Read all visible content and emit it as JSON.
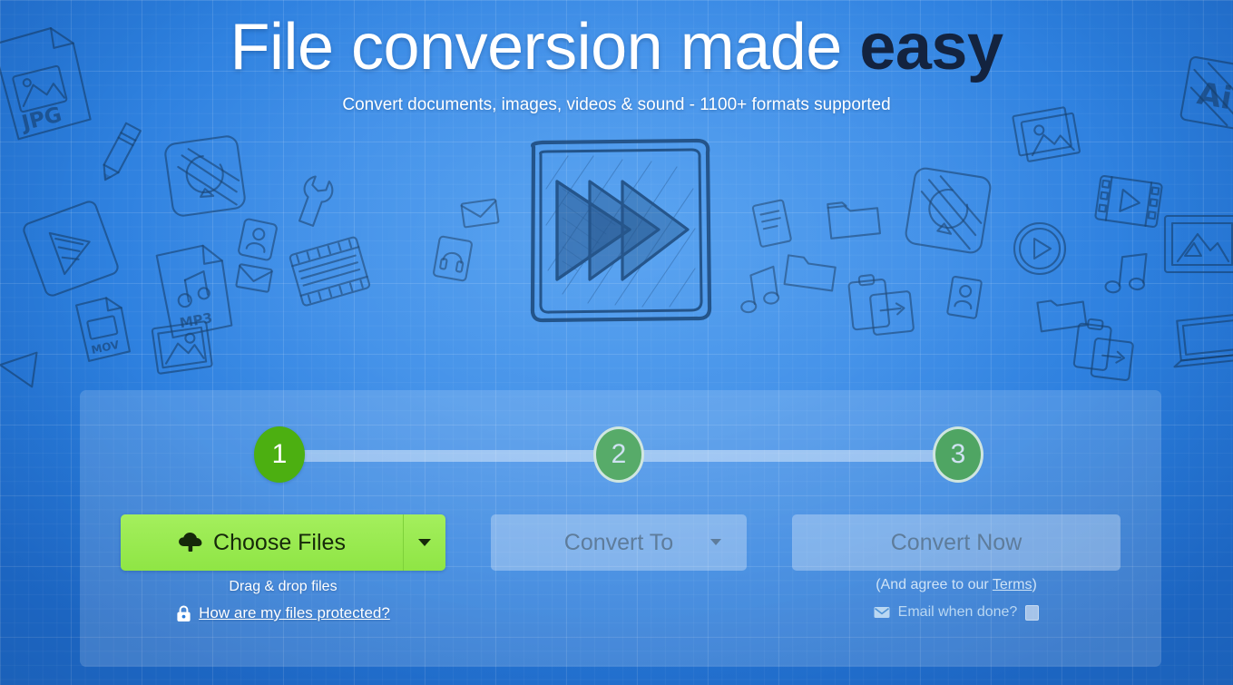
{
  "hero": {
    "headline_normal": "File conversion made ",
    "headline_strong": "easy",
    "subheadline": "Convert documents, images, videos & sound - 1100+ formats supported"
  },
  "center_illustration": {
    "icon": "fast-forward-sketch-icon"
  },
  "stepper": {
    "steps": [
      {
        "number": "1",
        "state": "active"
      },
      {
        "number": "2",
        "state": "inactive"
      },
      {
        "number": "3",
        "state": "inactive"
      }
    ]
  },
  "controls": {
    "choose_files_label": "Choose Files",
    "choose_files_icon": "cloud-upload-icon",
    "choose_files_dropdown_icon": "caret-down-icon",
    "convert_to_label": "Convert To",
    "convert_to_icon": "caret-down-icon",
    "convert_now_label": "Convert Now"
  },
  "footnotes": {
    "drag_drop_text": "Drag & drop files",
    "protected_link_icon": "lock-icon",
    "protected_link_label": "How are my files protected?",
    "terms_prefix": "(And agree to our ",
    "terms_link_label": "Terms",
    "terms_suffix": ")",
    "email_icon": "envelope-icon",
    "email_label": "Email when done?",
    "email_checked": false
  },
  "colors": {
    "background_blue": "#2a7ddd",
    "accent_green": "#8fe545",
    "step_active_green": "#4caf11",
    "step_inactive_green": "#57ab69",
    "panel_overlay": "rgba(255,255,255,0.155)",
    "muted_button_text": "#5e7c9b",
    "headline_strong": "#13233f",
    "doodle_stroke": "#17406f"
  },
  "background_doodles": [
    "jpg-file-icon",
    "pencil-icon",
    "refresh-icon",
    "triangle-play-icon",
    "mp3-file-icon",
    "envelope-icon",
    "film-strip-icon",
    "image-file-icon",
    "contact-card-icon",
    "wrench-icon",
    "mov-file-icon",
    "folder-icon",
    "clipboard-icon",
    "music-note-icon",
    "photo-stack-icon",
    "play-circle-icon",
    "ai-file-icon",
    "video-frames-icon",
    "laptop-icon",
    "picture-frame-icon",
    "headphones-icon",
    "document-icon"
  ]
}
